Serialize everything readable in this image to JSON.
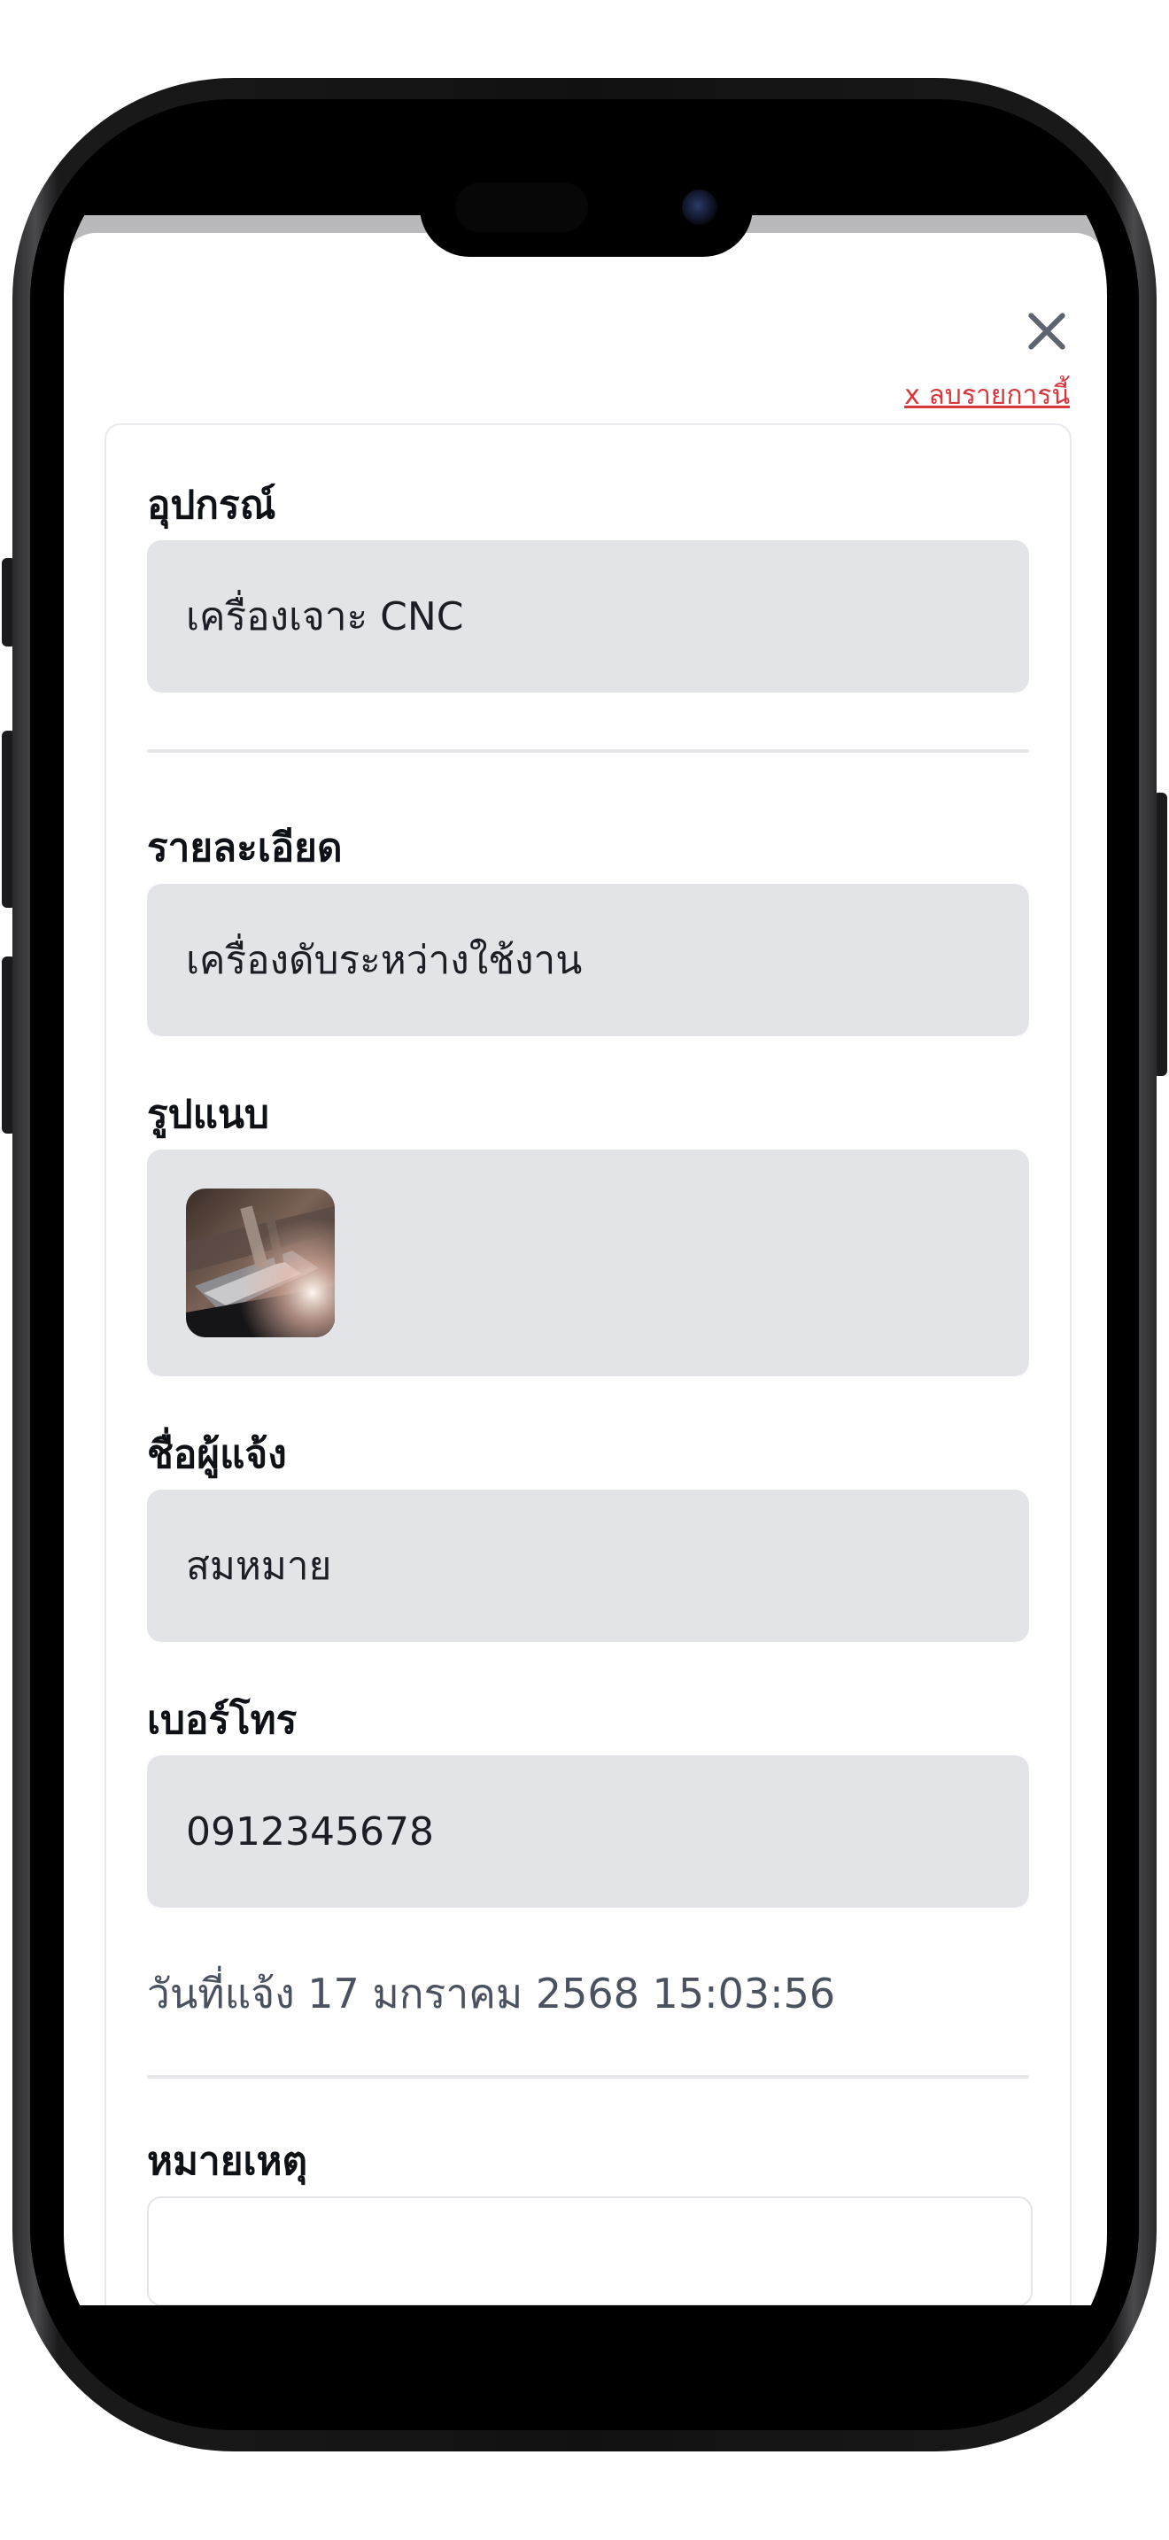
{
  "sheet": {
    "close_icon": "close-icon",
    "delete_link_label": "x ลบรายการนี้"
  },
  "form": {
    "equipment": {
      "label": "อุปกรณ์",
      "value": "เครื่องเจาะ CNC"
    },
    "detail": {
      "label": "รายละเอียด",
      "value": "เครื่องดับระหว่างใช้งาน"
    },
    "attachment": {
      "label": "รูปแนบ",
      "thumbnail_icon": "cnc-photo-thumbnail"
    },
    "reporter_name": {
      "label": "ชื่อผู้แจ้ง",
      "value": "สมหมาย"
    },
    "phone": {
      "label": "เบอร์โทร",
      "value": "0912345678"
    },
    "reported_date": "วันที่แจ้ง 17 มกราคม 2568 15:03:56",
    "note": {
      "label": "หมายเหตุ",
      "value": ""
    }
  },
  "colors": {
    "accent_red": "#d9363e",
    "field_bg": "#e2e4e8",
    "label_text": "#0e1116",
    "secondary_text": "#4a5260"
  }
}
